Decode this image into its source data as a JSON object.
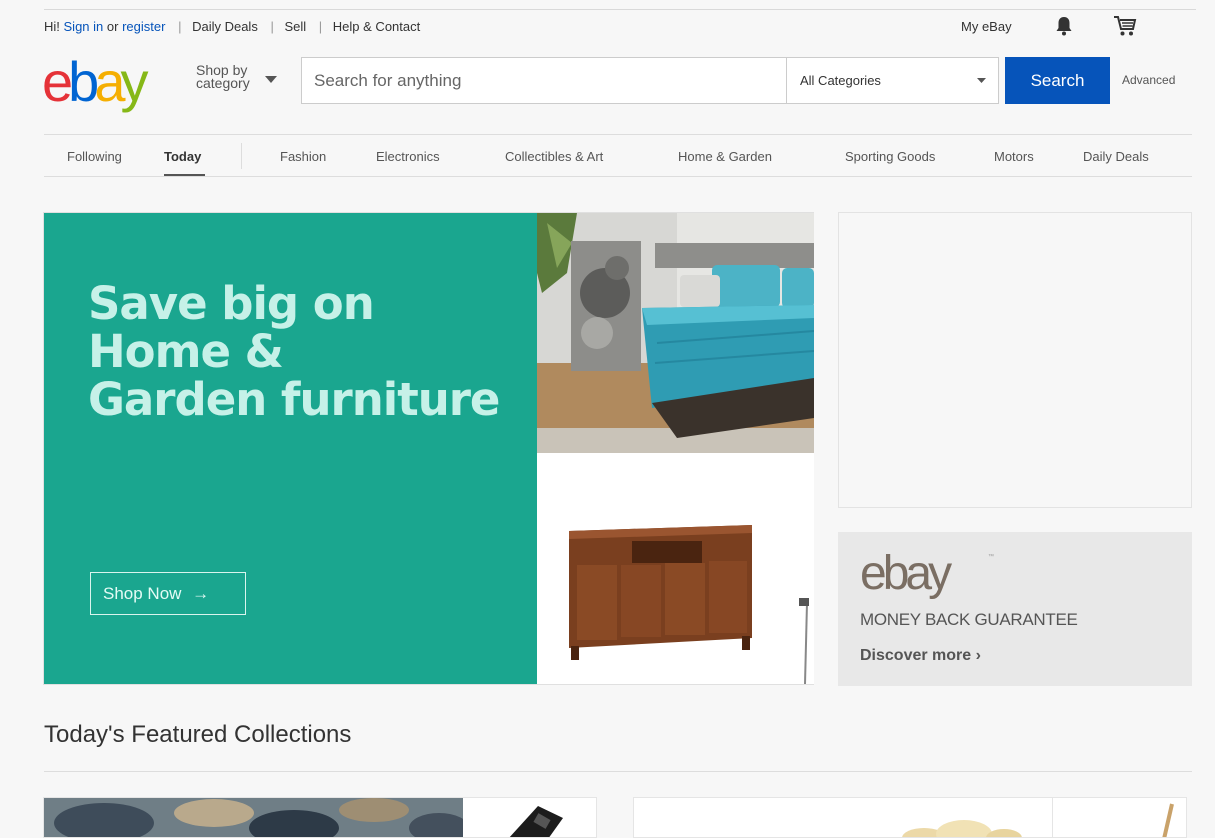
{
  "topbar": {
    "greeting": "Hi!",
    "sign_in": "Sign in",
    "or": "or",
    "register": "register",
    "links": [
      "Daily Deals",
      "Sell",
      "Help & Contact"
    ],
    "my_ebay": "My eBay",
    "bell_icon": "bell-icon",
    "cart_icon": "cart-icon"
  },
  "header": {
    "logo_letters": [
      "e",
      "b",
      "a",
      "y"
    ],
    "logo_colors": [
      "#e53238",
      "#0064d2",
      "#f5af02",
      "#86b817"
    ],
    "shop_by_line1": "Shop by",
    "shop_by_line2": "category",
    "search_placeholder": "Search for anything",
    "category_selected": "All Categories",
    "search_button": "Search",
    "advanced": "Advanced",
    "accent": "#0654ba"
  },
  "nav": {
    "items": [
      {
        "label": "Following",
        "active": false
      },
      {
        "label": "Today",
        "active": true
      },
      {
        "label": "Fashion",
        "active": false
      },
      {
        "label": "Electronics",
        "active": false
      },
      {
        "label": "Collectibles & Art",
        "active": false
      },
      {
        "label": "Home & Garden",
        "active": false
      },
      {
        "label": "Sporting Goods",
        "active": false
      },
      {
        "label": "Motors",
        "active": false
      },
      {
        "label": "Daily Deals",
        "active": false
      }
    ]
  },
  "hero": {
    "headline_lines": [
      "Save big on",
      "Home &",
      "Garden furniture"
    ],
    "cta": "Shop Now",
    "cta_arrow": "→",
    "background": "#1aa68f"
  },
  "guarantee": {
    "logo": "ebay",
    "tm": "™",
    "text": "MONEY BACK GUARANTEE",
    "link": "Discover more",
    "link_chevron": "›"
  },
  "featured": {
    "title": "Today's Featured Collections"
  }
}
